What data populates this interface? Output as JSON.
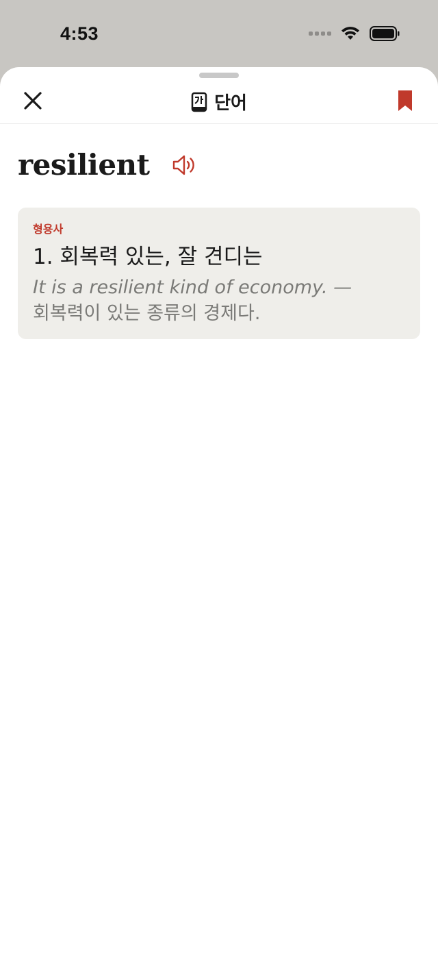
{
  "status": {
    "time": "4:53"
  },
  "header": {
    "title": "단어",
    "icons": {
      "close": "close-icon",
      "dictionary": "korean-dictionary-icon",
      "bookmark": "bookmark-icon"
    }
  },
  "entry": {
    "word": "resilient",
    "speaker_icon": "speaker-icon",
    "definitions": [
      {
        "part_of_speech": "형용사",
        "text": "1. 회복력 있는, 잘 견디는",
        "example_en": "It is a resilient kind of economy. —",
        "example_ko": "회복력이 있는 종류의 경제다."
      }
    ]
  },
  "colors": {
    "accent": "#c0392b",
    "card_bg": "#efeeea",
    "status_bg": "#c8c6c2"
  }
}
